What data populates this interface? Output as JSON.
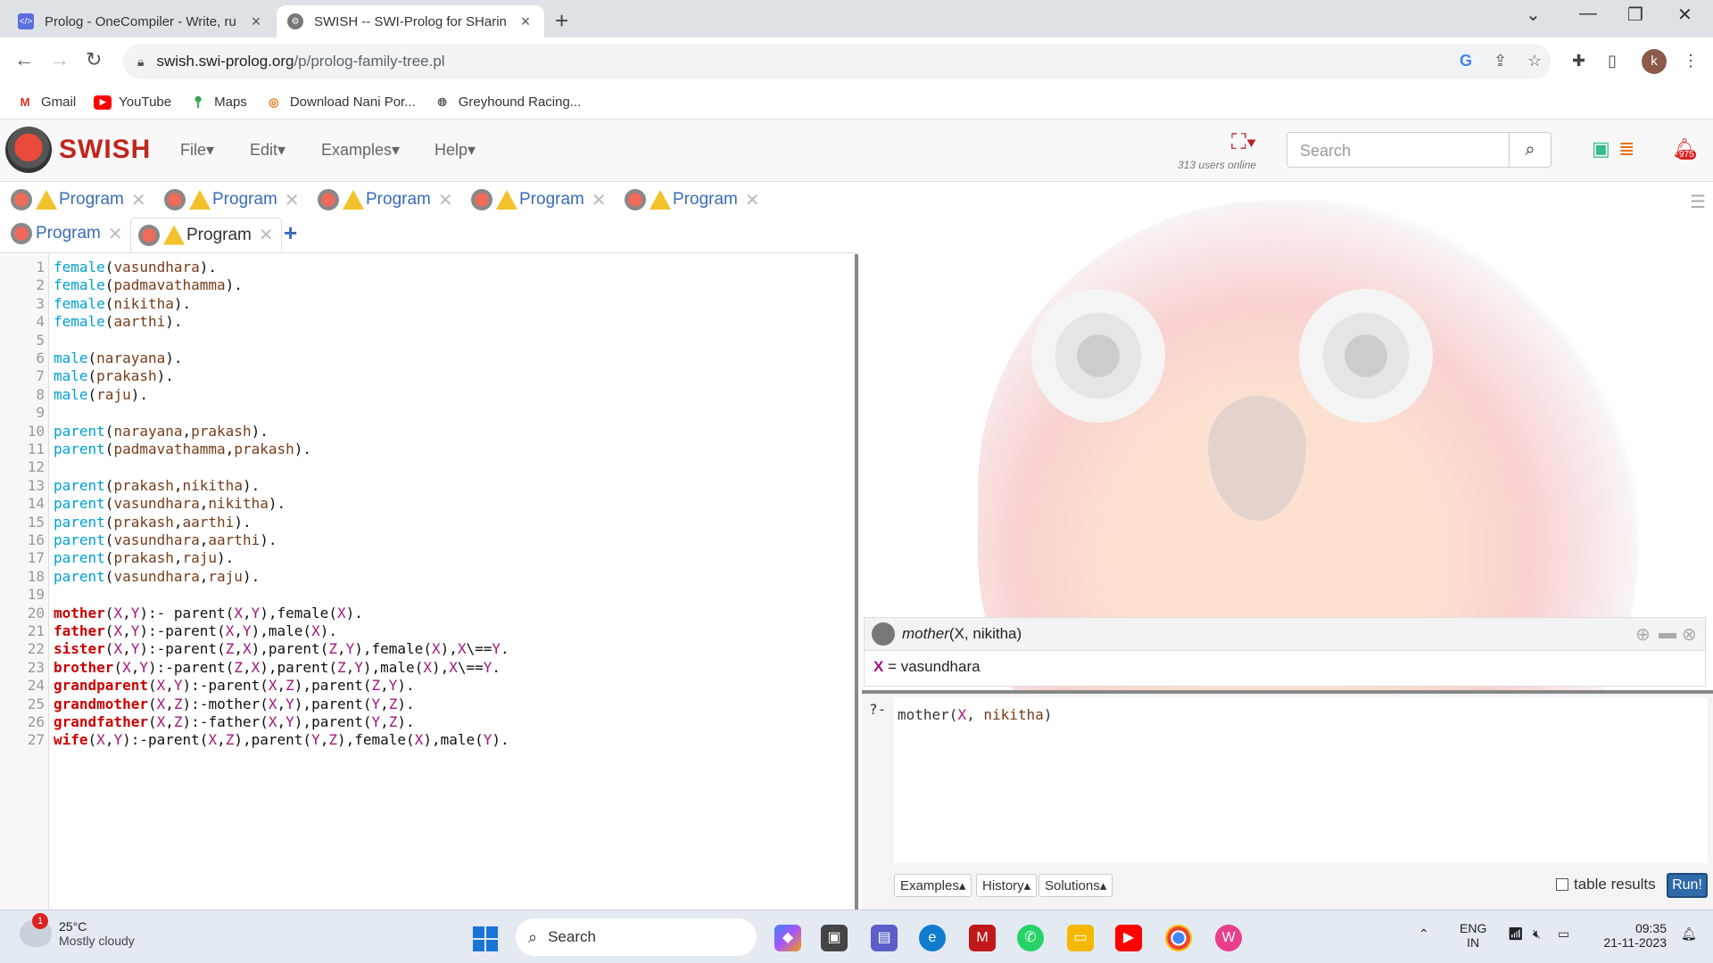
{
  "browser": {
    "tabs": [
      {
        "title": "Prolog - OneCompiler - Write, ru",
        "favicon": "code-icon"
      },
      {
        "title": "SWISH -- SWI-Prolog for SHarin",
        "favicon": "swish-gear-icon"
      }
    ],
    "url_host": "swish.swi-prolog.org",
    "url_path": "/p/prolog-family-tree.pl",
    "profile_initial": "k",
    "bookmarks": [
      "Gmail",
      "YouTube",
      "Maps",
      "Download Nani Por...",
      "Greyhound Racing..."
    ]
  },
  "swish": {
    "brand": "SWISH",
    "menus": [
      "File",
      "Edit",
      "Examples",
      "Help"
    ],
    "users_online": "313 users online",
    "search_placeholder": "Search",
    "notification_count": "975",
    "tabs": [
      "Program",
      "Program",
      "Program",
      "Program",
      "Program",
      "Program",
      "Program"
    ]
  },
  "code_lines": [
    "female(vasundhara).",
    "female(padmavathamma).",
    "female(nikitha).",
    "female(aarthi).",
    "",
    "male(narayana).",
    "male(prakash).",
    "male(raju).",
    "",
    "parent(narayana,prakash).",
    "parent(padmavathamma,prakash).",
    "",
    "parent(prakash,nikitha).",
    "parent(vasundhara,nikitha).",
    "parent(prakash,aarthi).",
    "parent(vasundhara,aarthi).",
    "parent(prakash,raju).",
    "parent(vasundhara,raju).",
    "",
    "mother(X,Y):- parent(X,Y),female(X).",
    "father(X,Y):-parent(X,Y),male(X).",
    "sister(X,Y):-parent(Z,X),parent(Z,Y),female(X),X\\==Y.",
    "brother(X,Y):-parent(Z,X),parent(Z,Y),male(X),X\\==Y.",
    "grandparent(X,Y):-parent(X,Z),parent(Z,Y).",
    "grandmother(X,Z):-mother(X,Y),parent(Y,Z).",
    "grandfather(X,Z):-father(X,Y),parent(Y,Z).",
    "wife(X,Y):-parent(X,Z),parent(Y,Z),female(X),male(Y)."
  ],
  "query_result": {
    "query_pred": "mother",
    "query_args": "(X, nikitha)",
    "answer_var": "X",
    "answer_eq": " = ",
    "answer_value": "vasundhara"
  },
  "query_editor": {
    "prompt": "?-",
    "text_pred": "mother(",
    "text_var": "X",
    "text_sep": ", ",
    "text_atom": "nikitha",
    "text_close": ")",
    "buttons": [
      "Examples▴",
      "History▴",
      "Solutions▴"
    ],
    "table_results_label": "table results",
    "run_label": "Run!"
  },
  "taskbar": {
    "weather_temp": "25°C",
    "weather_desc": "Mostly cloudy",
    "weather_badge": "1",
    "search_label": "Search",
    "lang_top": "ENG",
    "lang_bottom": "IN",
    "time": "09:35",
    "date": "21-11-2023"
  },
  "colors": {
    "swish_red": "#c0261d",
    "run_blue": "#2e6aa9",
    "builtin_cyan": "#00a0d6",
    "head_red": "#cc0000",
    "variable_purple": "#a0167e"
  }
}
